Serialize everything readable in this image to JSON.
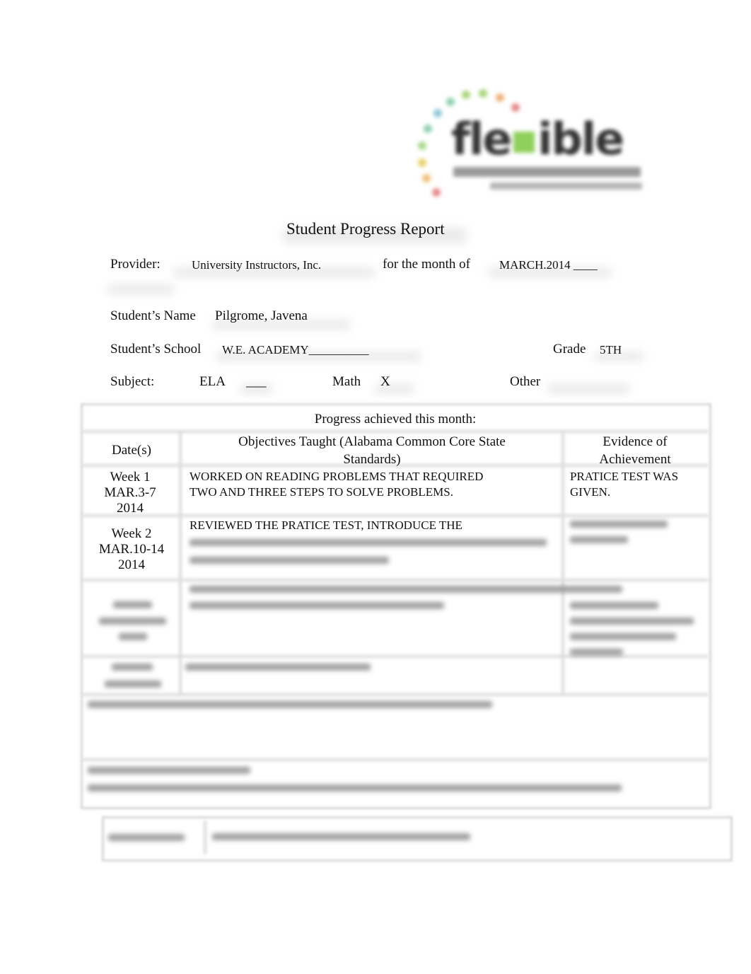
{
  "logo": {
    "brand_text_before": "fle",
    "brand_text_after": "ible",
    "accent_color": "#8fcf5a",
    "arc_colors": [
      "#e58a8a",
      "#f0b07a",
      "#e8d36a",
      "#a9d67a",
      "#8fd0b0",
      "#8ec7d6",
      "#a8d98a",
      "#f2c07a",
      "#e88a8a"
    ]
  },
  "header": {
    "title": "Student Progress Report"
  },
  "form": {
    "provider_label": "Provider:",
    "provider_value": "University Instructors, Inc.",
    "month_label": "for the month of",
    "month_value": "MARCH.2014 ____",
    "student_name_label": "Student’s Name",
    "student_name_value": "Pilgrome, Javena",
    "school_label": "Student’s School",
    "school_value": "W.E. ACADEMY__________",
    "grade_label": "Grade",
    "grade_value": "5TH",
    "subject_label": "Subject:",
    "ela_label": "ELA",
    "ela_value": "___",
    "math_label": "Math",
    "math_value": "X",
    "other_label": "Other"
  },
  "progress_table": {
    "caption": "Progress achieved this month:",
    "columns": {
      "dates": "Date(s)",
      "objectives_line1": "Objectives Taught (Alabama Common Core State",
      "objectives_line2": "Standards)",
      "evidence_line1": "Evidence of",
      "evidence_line2": "Achievement"
    },
    "rows": [
      {
        "week": "Week 1",
        "range": "MAR.3-7",
        "year": "2014",
        "objective_line1": "WORKED ON READING PROBLEMS THAT REQUIRED",
        "objective_line2": "TWO AND THREE STEPS TO SOLVE PROBLEMS.",
        "evidence_line1": "PRATICE TEST WAS",
        "evidence_line2": "GIVEN."
      },
      {
        "week": "Week 2",
        "range": "MAR.10-14",
        "year": "2014",
        "objective_line1": "REVIEWED THE PRATICE TEST, INTRODUCE THE",
        "objective_obscured": true,
        "evidence_obscured": true
      },
      {
        "obscured": true
      },
      {
        "obscured": true
      }
    ]
  },
  "obscured_sections": [
    "instructor-comments",
    "next-month-objectives",
    "instructor-signature"
  ]
}
